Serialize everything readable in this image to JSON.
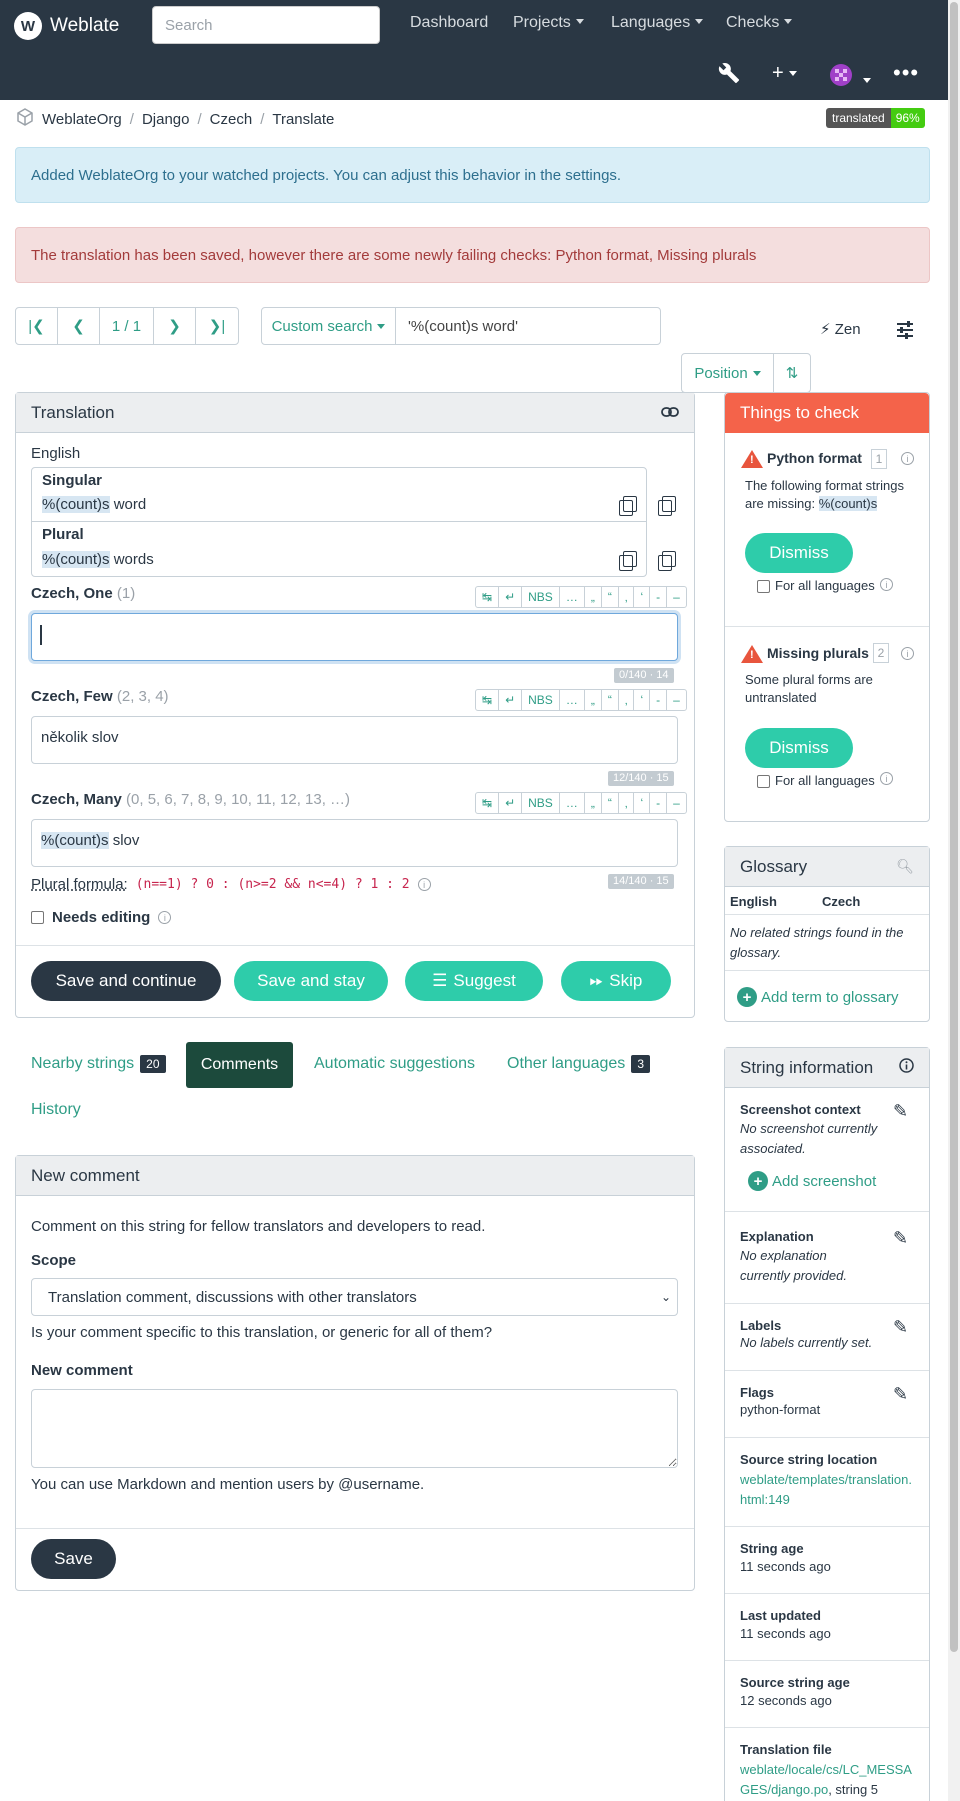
{
  "nav": {
    "brand": "Weblate",
    "search_placeholder": "Search",
    "links": [
      "Dashboard",
      "Projects",
      "Languages",
      "Checks"
    ]
  },
  "breadcrumb": [
    "WeblateOrg",
    "Django",
    "Czech",
    "Translate"
  ],
  "badge": {
    "label": "translated",
    "value": "96%"
  },
  "alerts": {
    "info": "Added WeblateOrg to your watched projects. You can adjust this behavior in the settings.",
    "danger": "The translation has been saved, however there are some newly failing checks: Python format, Missing plurals"
  },
  "pager": {
    "position": "1 / 1"
  },
  "search": {
    "dropdown": "Custom search",
    "query": "'%(count)s word'"
  },
  "zen": "Zen",
  "sort": {
    "label": "Position"
  },
  "translation": {
    "heading": "Translation",
    "source_lang": "English",
    "singular_label": "Singular",
    "singular_placeholder": "%(count)s",
    "singular_rest": " word",
    "plural_label": "Plural",
    "plural_placeholder": "%(count)s",
    "plural_rest": " words",
    "forms": [
      {
        "lang": "Czech, One",
        "hint": "(1)",
        "value": "",
        "counter": "0/140 · 14"
      },
      {
        "lang": "Czech, Few",
        "hint": "(2, 3, 4)",
        "value": "několik slov",
        "counter": "12/140 · 15"
      },
      {
        "lang": "Czech, Many",
        "hint": "(0, 5, 6, 7, 8, 9, 10, 11, 12, 13, …)",
        "value_placeholder": "%(count)s",
        "value_rest": " slov",
        "counter": "14/140 · 15"
      }
    ],
    "toolbar": [
      "NBS",
      "…",
      "„",
      "“",
      "‚",
      "‘",
      "-",
      "–"
    ],
    "plural_formula_label": "Plural formula:",
    "plural_formula": "(n==1) ? 0 : (n>=2 && n<=4) ? 1 : 2",
    "needs_editing": "Needs editing",
    "buttons": {
      "save_continue": "Save and continue",
      "save_stay": "Save and stay",
      "suggest": "Suggest",
      "skip": "Skip"
    }
  },
  "tabs": [
    {
      "label": "Nearby strings",
      "count": "20"
    },
    {
      "label": "Comments"
    },
    {
      "label": "Automatic suggestions"
    },
    {
      "label": "Other languages",
      "count": "3"
    },
    {
      "label": "History"
    }
  ],
  "comment": {
    "heading": "New comment",
    "intro": "Comment on this string for fellow translators and developers to read.",
    "scope_label": "Scope",
    "scope_value": "Translation comment, discussions with other translators",
    "scope_help": "Is your comment specific to this translation, or generic for all of them?",
    "comment_label": "New comment",
    "markdown_help": "You can use Markdown and mention users by @username.",
    "save": "Save"
  },
  "checks": {
    "heading": "Things to check",
    "items": [
      {
        "title": "Python format",
        "count": "1",
        "desc_prefix": "The following format strings are missing:",
        "desc_code": "%(count)s",
        "dismiss": "Dismiss",
        "all_langs": "For all languages"
      },
      {
        "title": "Missing plurals",
        "count": "2",
        "desc": "Some plural forms are untranslated",
        "dismiss": "Dismiss",
        "all_langs": "For all languages"
      }
    ]
  },
  "glossary": {
    "heading": "Glossary",
    "col_source": "English",
    "col_target": "Czech",
    "empty": "No related strings found in the glossary.",
    "add": "Add term to glossary"
  },
  "string_info": {
    "heading": "String information",
    "screenshot_title": "Screenshot context",
    "screenshot_value": "No screenshot currently associated.",
    "add_screenshot": "Add screenshot",
    "explanation_title": "Explanation",
    "explanation_value": "No explanation currently provided.",
    "labels_title": "Labels",
    "labels_value": "No labels currently set.",
    "flags_title": "Flags",
    "flags_value": "python-format",
    "location_title": "Source string location",
    "location_value": "weblate/templates/translation.html:149",
    "age_title": "String age",
    "age_value": "11 seconds ago",
    "updated_title": "Last updated",
    "updated_value": "11 seconds ago",
    "source_age_title": "Source string age",
    "source_age_value": "12 seconds ago",
    "file_title": "Translation file",
    "file_value": "weblate/locale/cs/LC_MESSAGES/django.po",
    "file_suffix": ", string 5"
  },
  "colors": {
    "navbar": "#2a3744",
    "accent": "#2eccaa",
    "link": "#2f9d86",
    "check_header": "#f4634a"
  }
}
